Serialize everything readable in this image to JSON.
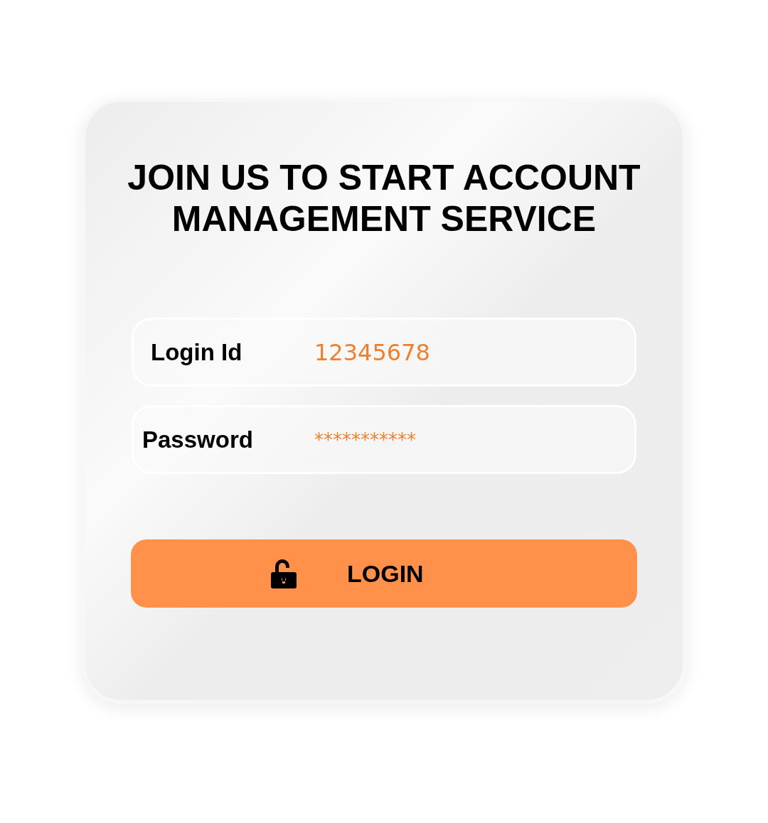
{
  "title": "JOIN US TO START ACCOUNT MANAGEMENT SERVICE",
  "fields": [
    {
      "label": "Login Id",
      "value": "12345678",
      "kind": "text"
    },
    {
      "label": "Password",
      "value": "***********",
      "kind": "password"
    }
  ],
  "button": {
    "label": "LOGIN"
  }
}
